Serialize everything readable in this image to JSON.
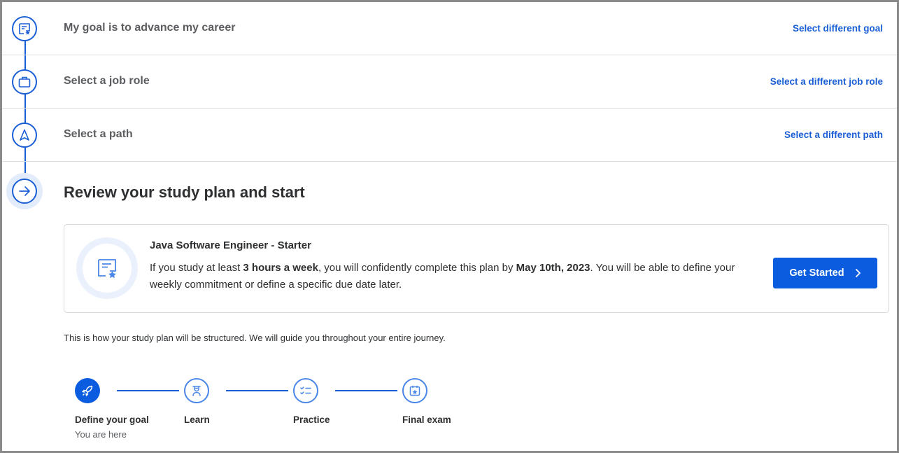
{
  "steps": [
    {
      "label": "My goal is to advance my career",
      "link": "Select different goal",
      "icon": "goal-certificate-icon"
    },
    {
      "label": "Select a job role",
      "link": "Select a different job role",
      "icon": "briefcase-icon"
    },
    {
      "label": "Select a path",
      "link": "Select a different path",
      "icon": "navigation-arrow-icon"
    }
  ],
  "review": {
    "title": "Review your study plan and start",
    "icon": "arrow-right-icon"
  },
  "plan": {
    "title": "Java Software Engineer - Starter",
    "desc_pre": "If you study at least ",
    "hours": "3 hours a week",
    "desc_mid": ", you will confidently complete this plan by ",
    "date": "May 10th, 2023",
    "desc_post": ". You will be able to define your weekly commitment or define a specific due date later.",
    "button": "Get Started",
    "badge_icon": "certificate-star-icon"
  },
  "structure_note": "This is how your study plan will be structured. We will guide you throughout your entire journey.",
  "stages": [
    {
      "label": "Define your goal",
      "sub": "You are here",
      "icon": "rocket-icon",
      "active": true
    },
    {
      "label": "Learn",
      "sub": "",
      "icon": "learner-icon",
      "active": false
    },
    {
      "label": "Practice",
      "sub": "",
      "icon": "checklist-icon",
      "active": false
    },
    {
      "label": "Final exam",
      "sub": "",
      "icon": "exam-calendar-star-icon",
      "active": false
    }
  ],
  "colors": {
    "accent": "#0b5cde",
    "link": "#1a5fd6",
    "text": "#2d2f31",
    "muted": "#5b5d60"
  }
}
